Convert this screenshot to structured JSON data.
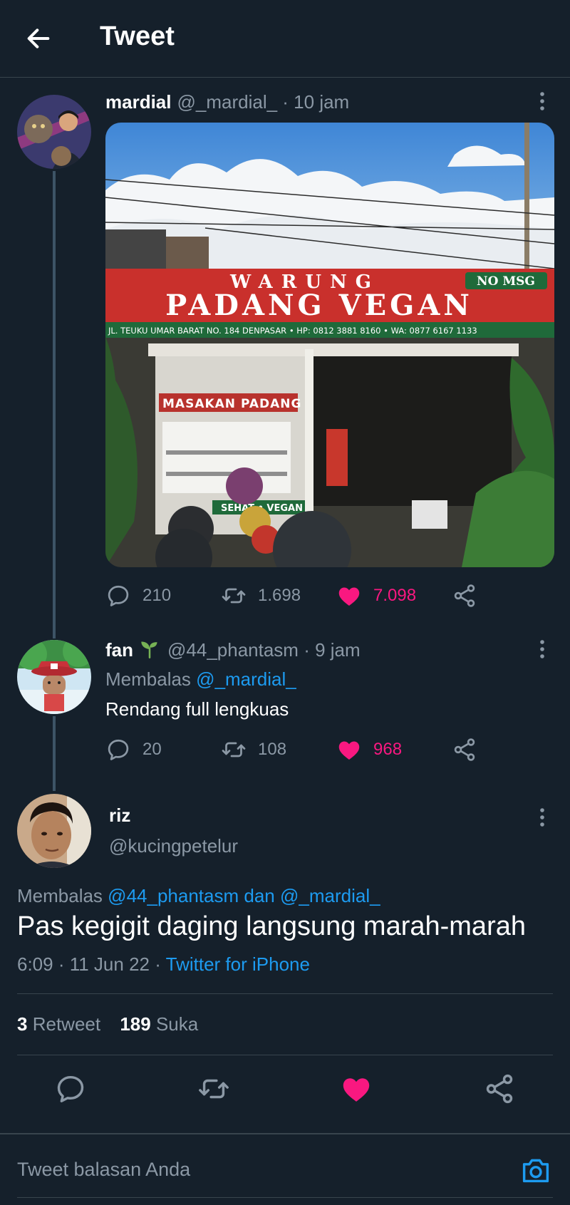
{
  "header": {
    "title": "Tweet"
  },
  "tweet1": {
    "name": "mardial",
    "handle": "@_mardial_",
    "time": "· 10 jam",
    "sign_warung": "WARUNG",
    "sign_main": "PADANG VEGAN",
    "sign_badge": "NO MSG",
    "sign_address": "JL. TEUKU UMAR BARAT NO. 184 DENPASAR • HP: 0812 3881 8160 • WA: 0877 6167 1133",
    "sign_masakan": "MASAKAN PADANG",
    "sign_sehat": "SEHAT • VEGAN",
    "replies": "210",
    "retweets": "1.698",
    "likes": "7.098"
  },
  "tweet2": {
    "name": "fan",
    "handle": "@44_phantasm",
    "time": "· 9 jam",
    "replying_prefix": "Membalas",
    "replying_to": "@_mardial_",
    "text": "Rendang full lengkuas",
    "replies": "20",
    "retweets": "108",
    "likes": "968"
  },
  "main_tweet": {
    "name": "riz",
    "handle": "@kucingpetelur",
    "replying_prefix": "Membalas",
    "replying_to_1": "@44_phantasm",
    "replying_joiner": "dan",
    "replying_to_2": "@_mardial_",
    "text": "Pas kegigit daging langsung marah-marah",
    "time": "6:09 · 11 Jun 22 ·",
    "source": "Twitter for iPhone",
    "retweet_count": "3",
    "retweet_label": "Retweet",
    "like_count": "189",
    "like_label": "Suka"
  },
  "reply_box": {
    "placeholder": "Tweet balasan Anda"
  },
  "colors": {
    "background": "#15202b",
    "accent_blue": "#1d9bf0",
    "like_pink": "#f91880",
    "muted_text": "#8b98a5",
    "divider": "#38444d"
  },
  "icons": [
    "back-arrow-icon",
    "more-icon",
    "reply-icon",
    "retweet-icon",
    "heart-icon",
    "share-icon",
    "sprout-emoji-icon",
    "camera-icon"
  ]
}
